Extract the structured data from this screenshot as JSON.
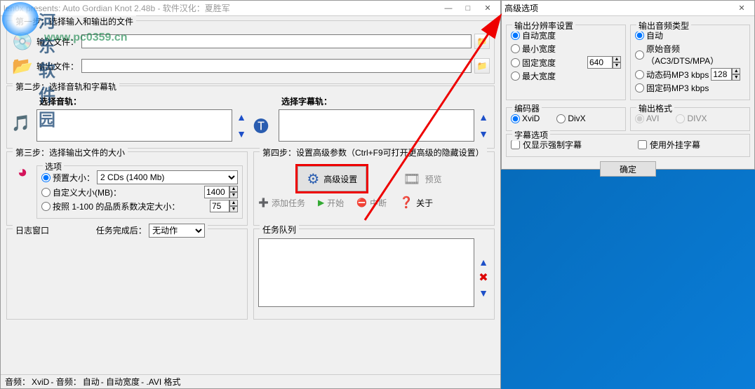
{
  "main": {
    "title": "len0x presents: Auto Gordian Knot 2.48b - 软件汉化：夏胜军",
    "watermark_text": "河东软件园",
    "watermark_url": "www.pc0359.cn",
    "step1": {
      "legend": "第一步：选择输入和输出的文件",
      "input_label": "输入文件：",
      "output_label": "输出文件："
    },
    "step2": {
      "legend": "第二步：选择音轨和字幕轨",
      "audio_label": "选择音轨：",
      "subtitle_label": "选择字幕轨："
    },
    "step3": {
      "legend": "第三步：选择输出文件的大小",
      "options_legend": "选项",
      "preset_label": "预置大小：",
      "preset_value": "2 CDs (1400 Mb)",
      "custom_label": "自定义大小(MB)：",
      "custom_value": "1400",
      "quality_label": "按照 1-100 的品质系数决定大小：",
      "quality_value": "75"
    },
    "step4": {
      "legend": "第四步：设置高级参数（Ctrl+F9可打开更高级的隐藏设置）",
      "advanced_btn": "高级设置",
      "preview_btn": "预览"
    },
    "toolbar": {
      "add_task": "添加任务",
      "start": "开始",
      "stop": "中断",
      "about": "关于"
    },
    "log": {
      "legend": "日志窗口",
      "after_label": "任务完成后：",
      "after_value": "无动作"
    },
    "queue_legend": "任务队列",
    "status": {
      "video_l": "音频：",
      "video_v": "XviD",
      "audio_l": "- 音频：",
      "audio_v": "自动",
      "width_l": "- 自动宽度",
      "format_l": "- .AVI 格式"
    }
  },
  "adv": {
    "title": "高级选项",
    "res": {
      "legend": "输出分辨率设置",
      "auto": "自动宽度",
      "min": "最小宽度",
      "fixed": "固定宽度",
      "max": "最大宽度",
      "value": "640"
    },
    "audio_out": {
      "legend": "输出音频类型",
      "auto": "自动",
      "orig": "原始音频（AC3/DTS/MPA）",
      "vbr": "动态码MP3 kbps",
      "cbr": "固定码MP3 kbps",
      "value": "128"
    },
    "encoder": {
      "legend": "编码器",
      "xvid": "XviD",
      "divx": "DivX"
    },
    "outfmt": {
      "legend": "输出格式",
      "avi": "AVI",
      "divx": "DIVX"
    },
    "subs": {
      "legend": "字幕选项",
      "force": "仅显示强制字幕",
      "ext": "使用外挂字幕"
    },
    "ok": "确定"
  }
}
